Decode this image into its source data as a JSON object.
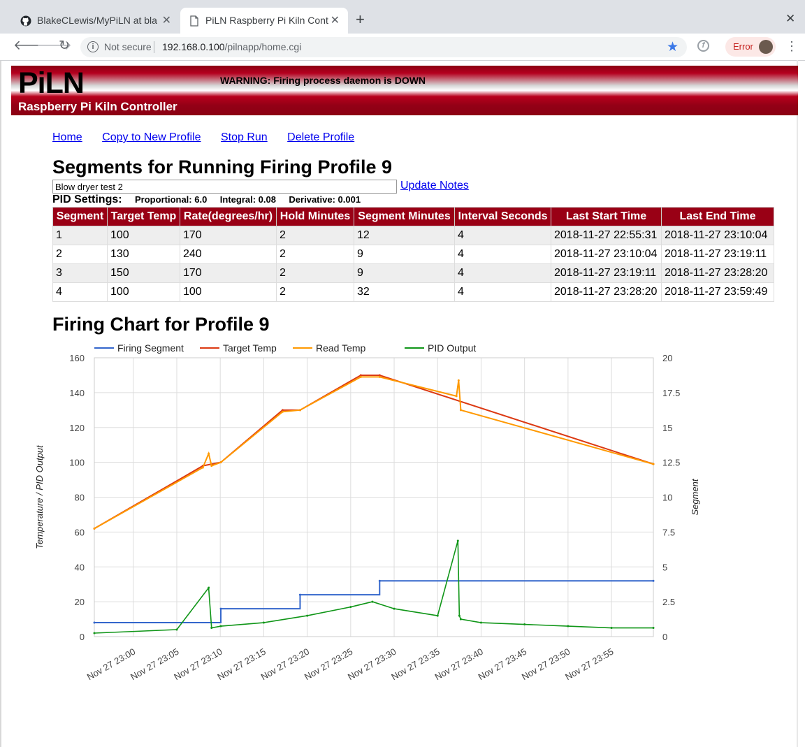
{
  "browser": {
    "tabs": [
      {
        "label": "BlakeCLewis/MyPiLN at bla",
        "icon": "github-icon"
      },
      {
        "label": "PiLN Raspberry Pi Kiln Cont",
        "icon": "page-icon"
      }
    ],
    "security": "Not secure",
    "url_host": "192.168.0.100",
    "url_path": "/pilnapp/home.cgi",
    "error_label": "Error"
  },
  "header": {
    "logo": "PiLN",
    "tagline": "Raspberry Pi Kiln Controller",
    "warning": "WARNING: Firing process daemon is DOWN",
    "bg_color": "#8b0012"
  },
  "nav": {
    "home": "Home",
    "copy": "Copy to New Profile",
    "stop": "Stop Run",
    "delete": "Delete Profile"
  },
  "segments": {
    "title": "Segments for Running Firing Profile 9",
    "notes_value": "Blow dryer test 2",
    "update_label": "Update Notes",
    "pid_label": "PID Settings:",
    "proportional": "Proportional: 6.0",
    "integral": "Integral: 0.08",
    "derivative": "Derivative: 0.001",
    "columns": [
      "Segment",
      "Target Temp",
      "Rate(degrees/hr)",
      "Hold Minutes",
      "Segment Minutes",
      "Interval Seconds",
      "Last Start Time",
      "Last End Time"
    ],
    "rows": [
      [
        "1",
        "100",
        "170",
        "2",
        "12",
        "4",
        "2018-11-27 22:55:31",
        "2018-11-27 23:10:04"
      ],
      [
        "2",
        "130",
        "240",
        "2",
        "9",
        "4",
        "2018-11-27 23:10:04",
        "2018-11-27 23:19:11"
      ],
      [
        "3",
        "150",
        "170",
        "2",
        "9",
        "4",
        "2018-11-27 23:19:11",
        "2018-11-27 23:28:20"
      ],
      [
        "4",
        "100",
        "100",
        "2",
        "32",
        "4",
        "2018-11-27 23:28:20",
        "2018-11-27 23:59:49"
      ]
    ]
  },
  "chart_title": "Firing Chart for Profile 9",
  "chart_data": {
    "type": "line",
    "legend": "top",
    "grid": true,
    "ylabel": "Temperature / PID Output",
    "y2label": "Segment",
    "ylim": [
      0,
      160
    ],
    "y2lim": [
      0,
      20
    ],
    "yticks": [
      "0",
      "20",
      "40",
      "60",
      "80",
      "100",
      "120",
      "140",
      "160"
    ],
    "y2ticks": [
      "0",
      "2.5",
      "5",
      "7.5",
      "10",
      "12.5",
      "15",
      "17.5",
      "20"
    ],
    "xlim": [
      "2018-11-27 22:55:31",
      "2018-11-27 23:59:49"
    ],
    "xticks": [
      "Nov 27 23:00",
      "Nov 27 23:05",
      "Nov 27 23:10",
      "Nov 27 23:15",
      "Nov 27 23:20",
      "Nov 27 23:25",
      "Nov 27 23:30",
      "Nov 27 23:35",
      "Nov 27 23:40",
      "Nov 27 23:45",
      "Nov 27 23:50",
      "Nov 27 23:55"
    ],
    "xtick_times": [
      "2018-11-27 23:00",
      "2018-11-27 23:05",
      "2018-11-27 23:10",
      "2018-11-27 23:15",
      "2018-11-27 23:20",
      "2018-11-27 23:25",
      "2018-11-27 23:30",
      "2018-11-27 23:35",
      "2018-11-27 23:40",
      "2018-11-27 23:45",
      "2018-11-27 23:50",
      "2018-11-27 23:55"
    ],
    "series": [
      {
        "name": "Firing Segment",
        "axis": "right",
        "color": "#3366cc",
        "step": true,
        "x": [
          "2018-11-27 22:55:31",
          "2018-11-27 23:10:04",
          "2018-11-27 23:19:11",
          "2018-11-27 23:28:20",
          "2018-11-27 23:59:49"
        ],
        "y": [
          1,
          2,
          3,
          4,
          4
        ]
      },
      {
        "name": "Target Temp",
        "axis": "left",
        "color": "#dc3912",
        "x": [
          "2018-11-27 22:55:31",
          "2018-11-27 23:08:00",
          "2018-11-27 23:10:04",
          "2018-11-27 23:17:10",
          "2018-11-27 23:19:11",
          "2018-11-27 23:26:10",
          "2018-11-27 23:28:20",
          "2018-11-27 23:59:49"
        ],
        "y": [
          62,
          98,
          100,
          130,
          130,
          150,
          150,
          99
        ]
      },
      {
        "name": "Read Temp",
        "axis": "left",
        "color": "#ff9900",
        "x": [
          "2018-11-27 22:55:31",
          "2018-11-27 23:08:00",
          "2018-11-27 23:08:40",
          "2018-11-27 23:09:00",
          "2018-11-27 23:10:04",
          "2018-11-27 23:17:10",
          "2018-11-27 23:19:11",
          "2018-11-27 23:26:10",
          "2018-11-27 23:28:20",
          "2018-11-27 23:37:10",
          "2018-11-27 23:37:25",
          "2018-11-27 23:37:40",
          "2018-11-27 23:59:49"
        ],
        "y": [
          62,
          97,
          105,
          98,
          100,
          129,
          130,
          149,
          149,
          138,
          147,
          130,
          99
        ]
      },
      {
        "name": "PID Output",
        "axis": "left",
        "color": "#109618",
        "x": [
          "2018-11-27 22:55:31",
          "2018-11-27 23:05:00",
          "2018-11-27 23:08:40",
          "2018-11-27 23:09:00",
          "2018-11-27 23:10:04",
          "2018-11-27 23:15:00",
          "2018-11-27 23:20:00",
          "2018-11-27 23:25:00",
          "2018-11-27 23:27:30",
          "2018-11-27 23:30:00",
          "2018-11-27 23:35:00",
          "2018-11-27 23:37:20",
          "2018-11-27 23:37:30",
          "2018-11-27 23:37:40",
          "2018-11-27 23:40:00",
          "2018-11-27 23:45:00",
          "2018-11-27 23:50:00",
          "2018-11-27 23:55:00",
          "2018-11-27 23:59:49"
        ],
        "y": [
          2,
          4,
          28,
          5,
          6,
          8,
          12,
          17,
          20,
          16,
          12,
          55,
          12,
          10,
          8,
          7,
          6,
          5,
          5
        ]
      }
    ]
  }
}
